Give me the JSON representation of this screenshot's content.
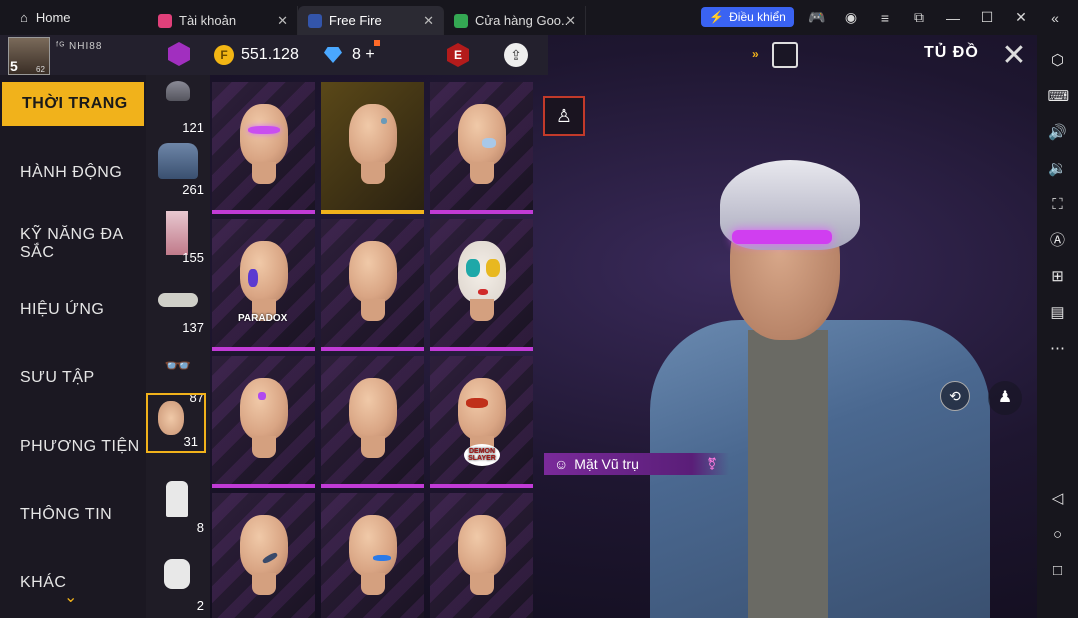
{
  "titlebar": {
    "home_label": "Home",
    "tabs": [
      {
        "label": "Tài khoản",
        "icon": "instagram-icon",
        "color": "#e0407a"
      },
      {
        "label": "Free Fire",
        "icon": "freefire-icon",
        "color": "#3355aa"
      },
      {
        "label": "Cửa hàng Goo...",
        "icon": "playstore-icon",
        "color": "#34a853"
      }
    ],
    "control_button": "Điều khiển",
    "window_icons": [
      "gamepad-icon",
      "account-icon",
      "menu-icon",
      "popout-icon",
      "minimize-icon",
      "maximize-icon",
      "close-icon",
      "collapse-sidebar-icon"
    ]
  },
  "player": {
    "level": "5",
    "sub_level": "62",
    "name": "ᶠᴳ NHI88"
  },
  "currency": {
    "gold": "551.128",
    "diamonds": "8",
    "plus": "+"
  },
  "header": {
    "title": "TỦ ĐỒ",
    "close": "✕"
  },
  "categories": [
    {
      "label": "THỜI TRANG",
      "active": true
    },
    {
      "label": "HÀNH ĐỘNG",
      "active": false
    },
    {
      "label": "KỸ NĂNG ĐA SẮC",
      "active": false
    },
    {
      "label": "HIỆU ỨNG",
      "active": false
    },
    {
      "label": "SƯU TẬP",
      "active": false
    },
    {
      "label": "PHƯƠNG TIỆN",
      "active": false
    },
    {
      "label": "THÔNG TIN",
      "active": false
    },
    {
      "label": "KHÁC",
      "active": false
    }
  ],
  "subcategories": [
    {
      "icon": "headgear-icon",
      "count": "121"
    },
    {
      "icon": "jacket-icon",
      "count": "261"
    },
    {
      "icon": "pants-icon",
      "count": "155"
    },
    {
      "icon": "shoes-icon",
      "count": "137"
    },
    {
      "icon": "glasses-icon",
      "count": "87"
    },
    {
      "icon": "face-paint-icon",
      "count": "31",
      "active": true
    },
    {
      "icon": "outfit-icon",
      "count": "8"
    },
    {
      "icon": "bag-icon",
      "count": "2"
    }
  ],
  "items": [
    {
      "paint": "purple-eyes",
      "selected": false,
      "equipped": true
    },
    {
      "paint": "bronze-gem",
      "selected": true,
      "equipped": false
    },
    {
      "paint": "cheek-blush",
      "selected": false,
      "equipped": false
    },
    {
      "paint": "paradox",
      "logo": "PARADOX",
      "selected": false,
      "equipped": false
    },
    {
      "paint": "plain",
      "selected": false,
      "equipped": false
    },
    {
      "paint": "joker",
      "selected": false,
      "equipped": false
    },
    {
      "paint": "purple-sparkle",
      "selected": false,
      "equipped": false
    },
    {
      "paint": "plain",
      "selected": false,
      "equipped": false
    },
    {
      "paint": "demon-slayer",
      "logo": "DEMON SLAYER",
      "selected": false,
      "equipped": false
    },
    {
      "paint": "dark-streak",
      "selected": false,
      "equipped": false
    },
    {
      "paint": "blue-mark",
      "selected": false,
      "equipped": false
    },
    {
      "paint": "plain",
      "selected": false,
      "equipped": false
    }
  ],
  "preview": {
    "item_name": "Mặt Vũ trụ",
    "gender_icon": "⚧"
  },
  "colors": {
    "accent": "#f1b21b",
    "rarity": "#c13bd6",
    "control": "#3a63f2"
  }
}
